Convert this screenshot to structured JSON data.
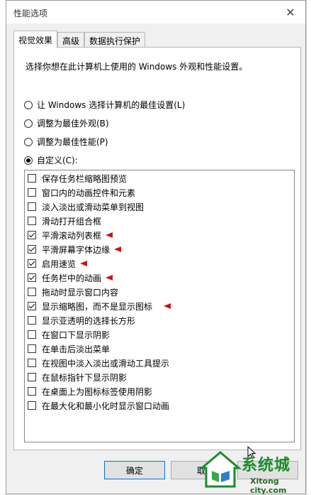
{
  "window": {
    "title": "性能选项",
    "close_label": "✕"
  },
  "tabs": [
    {
      "label": "视觉效果",
      "active": true
    },
    {
      "label": "高级",
      "active": false
    },
    {
      "label": "数据执行保护",
      "active": false
    }
  ],
  "description": "选择你想在此计算机上使用的 Windows 外观和性能设置。",
  "radio_options": [
    {
      "label": "让 Windows 选择计算机的最佳设置(L)",
      "checked": false
    },
    {
      "label": "调整为最佳外观(B)",
      "checked": false
    },
    {
      "label": "调整为最佳性能(P)",
      "checked": false
    },
    {
      "label": "自定义(C):",
      "checked": true
    }
  ],
  "effects": [
    {
      "label": "保存任务栏缩略图预览",
      "checked": false,
      "marked": false
    },
    {
      "label": "窗口内的动画控件和元素",
      "checked": false,
      "marked": false
    },
    {
      "label": "淡入淡出或滑动菜单到视图",
      "checked": false,
      "marked": false
    },
    {
      "label": "滑动打开组合框",
      "checked": false,
      "marked": false
    },
    {
      "label": "平滑滚动列表框",
      "checked": true,
      "marked": true
    },
    {
      "label": "平滑屏幕字体边缘",
      "checked": true,
      "marked": true
    },
    {
      "label": "启用速览",
      "checked": true,
      "marked": true
    },
    {
      "label": "任务栏中的动画",
      "checked": true,
      "marked": true
    },
    {
      "label": "拖动时显示窗口内容",
      "checked": false,
      "marked": false
    },
    {
      "label": "显示缩略图，而不是显示图标",
      "checked": true,
      "marked": true
    },
    {
      "label": "显示亚透明的选择长方形",
      "checked": false,
      "marked": false
    },
    {
      "label": "在窗口下显示阴影",
      "checked": false,
      "marked": false
    },
    {
      "label": "在单击后淡出菜单",
      "checked": false,
      "marked": false
    },
    {
      "label": "在视图中淡入淡出或滑动工具提示",
      "checked": false,
      "marked": false
    },
    {
      "label": "在鼠标指针下显示阴影",
      "checked": false,
      "marked": false
    },
    {
      "label": "在桌面上为图标标签使用阴影",
      "checked": false,
      "marked": false
    },
    {
      "label": "在最大化和最小化时显示窗口动画",
      "checked": false,
      "marked": false
    }
  ],
  "buttons": {
    "ok": "确定",
    "cancel": "取",
    "apply": ""
  },
  "watermark": {
    "text": "系统城",
    "sub": "Xitong city.com"
  },
  "colors": {
    "marker": "#d01010",
    "watermark": "#1d8a2c"
  }
}
